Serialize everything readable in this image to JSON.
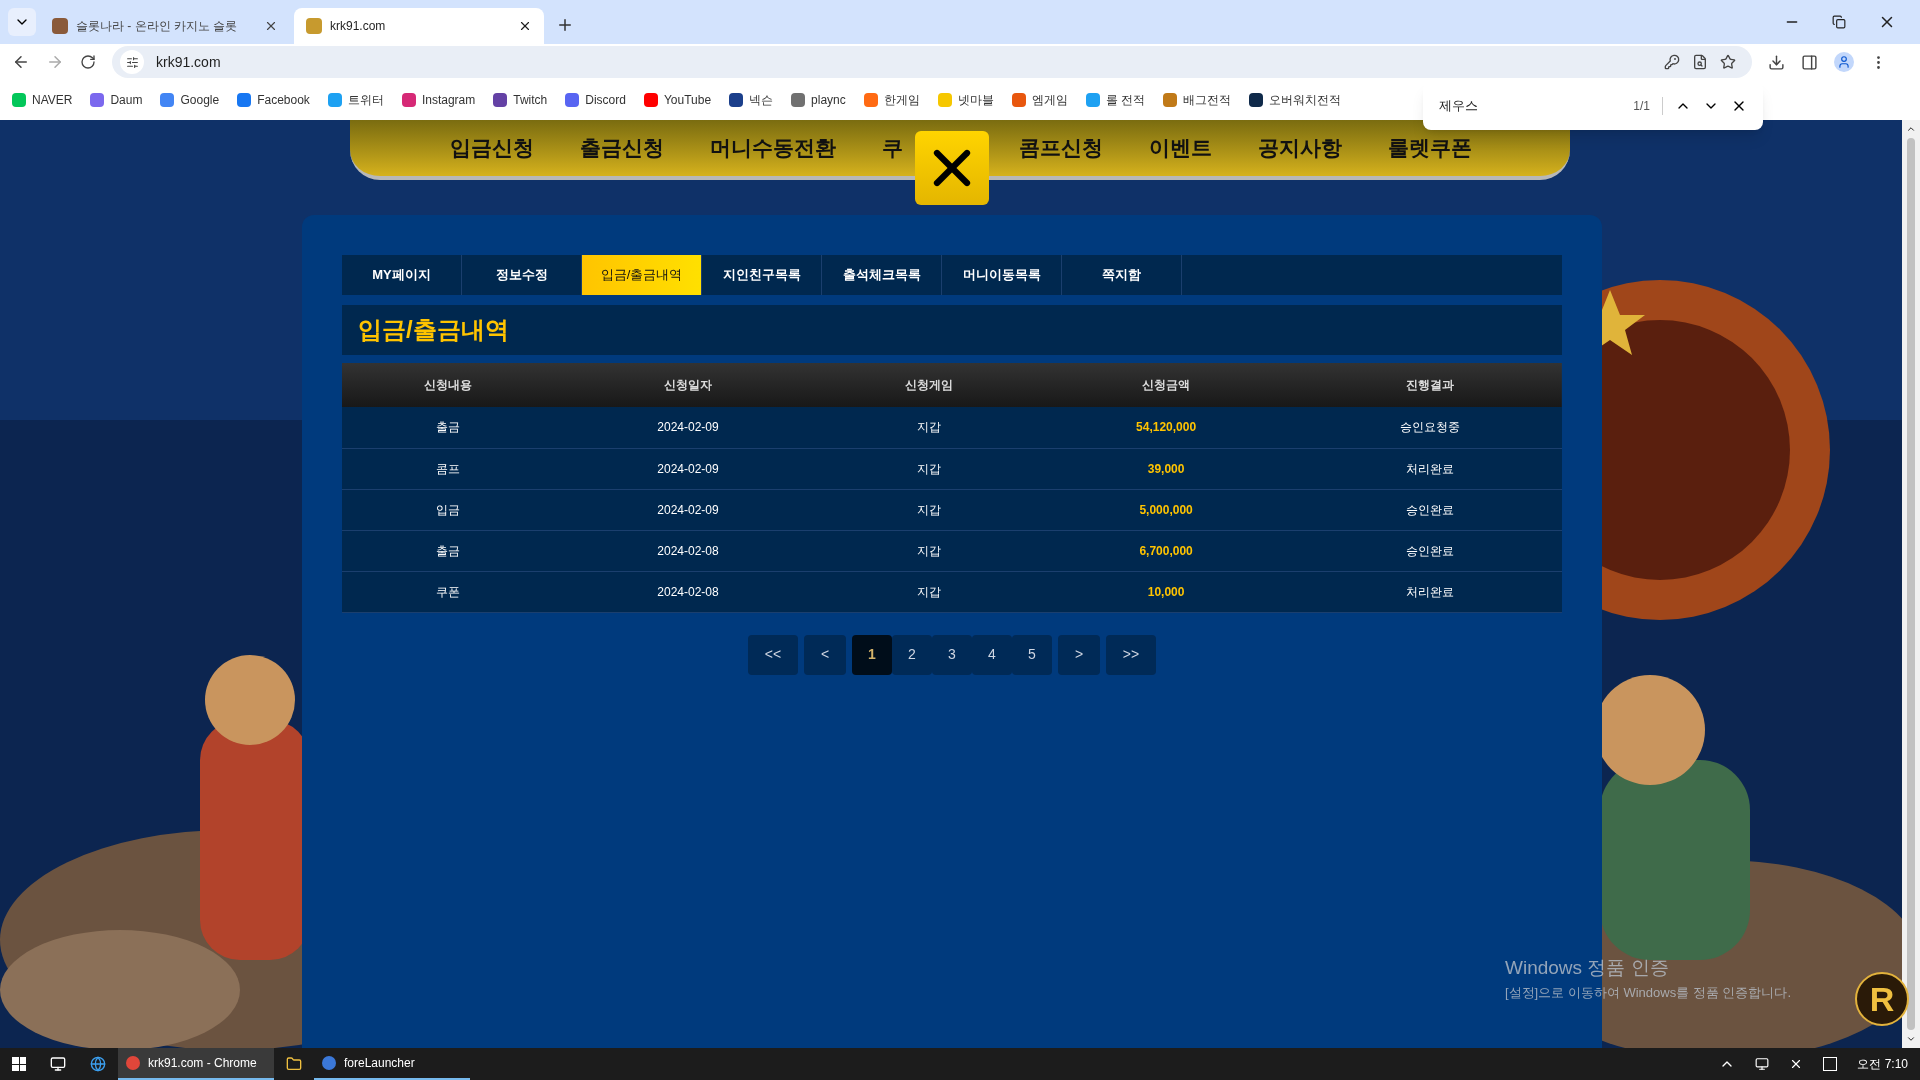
{
  "browser": {
    "tabs": [
      {
        "label": "슬롯나라 - 온라인 카지노 슬롯",
        "selected": false
      },
      {
        "label": "krk91.com",
        "selected": true
      }
    ],
    "url": "krk91.com",
    "bookmarks": [
      {
        "label": "NAVER",
        "color": "#03c75a"
      },
      {
        "label": "Daum",
        "color": "#7b68ee"
      },
      {
        "label": "Google",
        "color": "#4285f4"
      },
      {
        "label": "Facebook",
        "color": "#1877f2"
      },
      {
        "label": "트위터",
        "color": "#1da1f2"
      },
      {
        "label": "Instagram",
        "color": "#d62976"
      },
      {
        "label": "Twitch",
        "color": "#6441a5"
      },
      {
        "label": "Discord",
        "color": "#5865f2"
      },
      {
        "label": "YouTube",
        "color": "#ff0000"
      },
      {
        "label": "넥슨",
        "color": "#1b3f8b"
      },
      {
        "label": "plaync",
        "color": "#707070"
      },
      {
        "label": "한게임",
        "color": "#ff6a13"
      },
      {
        "label": "넷마블",
        "color": "#f6c700"
      },
      {
        "label": "엠게임",
        "color": "#e8570e"
      },
      {
        "label": "롤 전적",
        "color": "#1ea1f2"
      },
      {
        "label": "배그전적",
        "color": "#c07a18"
      },
      {
        "label": "오버워치전적",
        "color": "#0f2a4a"
      }
    ]
  },
  "find_bar": {
    "query": "제우스",
    "count": "1/1"
  },
  "site": {
    "nav": [
      "입금신청",
      "출금신청",
      "머니수동전환",
      "쿠",
      "콤프신청",
      "이벤트",
      "공지사항",
      "룰렛쿠폰"
    ],
    "tabs": [
      {
        "label": "MY페이지",
        "selected": false
      },
      {
        "label": "정보수정",
        "selected": false
      },
      {
        "label": "입금/출금내역",
        "selected": true
      },
      {
        "label": "지인친구목록",
        "selected": false
      },
      {
        "label": "출석체크목록",
        "selected": false
      },
      {
        "label": "머니이동목록",
        "selected": false
      },
      {
        "label": "쪽지함",
        "selected": false
      }
    ],
    "section_title": "입금/출금내역",
    "table": {
      "columns": [
        "신청내용",
        "신청일자",
        "신청게임",
        "신청금액",
        "진행결과"
      ],
      "rows": [
        [
          "출금",
          "2024-02-09",
          "지갑",
          "54,120,000",
          "승인요청중"
        ],
        [
          "콤프",
          "2024-02-09",
          "지갑",
          "39,000",
          "처리완료"
        ],
        [
          "입금",
          "2024-02-09",
          "지갑",
          "5,000,000",
          "승인완료"
        ],
        [
          "출금",
          "2024-02-08",
          "지갑",
          "6,700,000",
          "승인완료"
        ],
        [
          "쿠폰",
          "2024-02-08",
          "지갑",
          "10,000",
          "처리완료"
        ]
      ]
    },
    "pagination": {
      "first": "<<",
      "prev": "<",
      "pages": [
        {
          "label": "1",
          "selected": true
        },
        {
          "label": "2",
          "selected": false
        },
        {
          "label": "3",
          "selected": false
        },
        {
          "label": "4",
          "selected": false
        },
        {
          "label": "5",
          "selected": false
        }
      ],
      "next": ">",
      "last": ">>"
    }
  },
  "activation_notice": {
    "title": "Windows 정품 인증",
    "body": "[설정]으로 이동하여 Windows를 정품 인증합니다."
  },
  "logo_letter": "R",
  "taskbar": {
    "apps": [
      {
        "label": "krk91.com - Chrome",
        "selected": true
      },
      {
        "label": "foreLauncher",
        "selected": false
      }
    ],
    "clock": "오전 7:10"
  }
}
